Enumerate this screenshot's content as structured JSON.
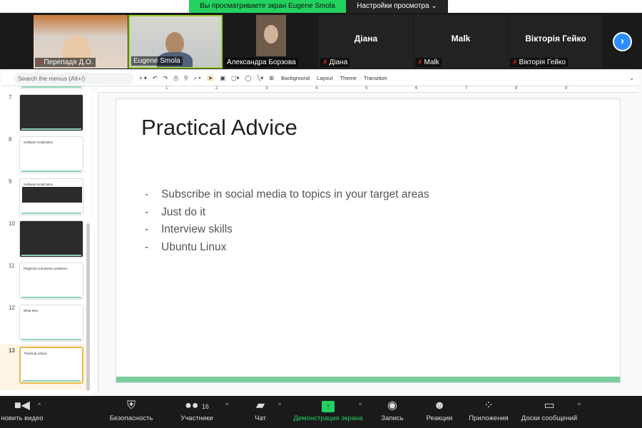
{
  "banner": {
    "text": "Вы просматриваете экран Eugene Smola",
    "settings": "Настройки просмотра"
  },
  "participants": [
    {
      "name": "Перепадя Д.О.",
      "muted": true
    },
    {
      "name": "Eugene Smola",
      "muted": false
    },
    {
      "name": "Александра Борзова",
      "muted": false
    },
    {
      "name": "Діана",
      "muted": true
    },
    {
      "name": "Malk",
      "muted": true
    },
    {
      "name": "Вікторія Гейко",
      "muted": true
    }
  ],
  "toolbar": {
    "search_placeholder": "Search the menus (Alt+/)",
    "background": "Background",
    "layout": "Layout",
    "theme": "Theme",
    "transition": "Transition"
  },
  "thumbnails": [
    {
      "num": "7",
      "title": ""
    },
    {
      "num": "8",
      "title": "Software localization"
    },
    {
      "num": "9",
      "title": "Software localization"
    },
    {
      "num": "10",
      "title": ""
    },
    {
      "num": "11",
      "title": "Plugins/to translation problems"
    },
    {
      "num": "12",
      "title": "What else"
    },
    {
      "num": "13",
      "title": "Practical Advice"
    }
  ],
  "ruler": [
    "1",
    "2",
    "3",
    "4",
    "5",
    "6",
    "7",
    "8",
    "9"
  ],
  "slide": {
    "title": "Practical Advice",
    "bullets": [
      "Subscribe in social media to topics in your target areas",
      "Just do it",
      "Interview skills",
      "Ubuntu Linux"
    ],
    "dash": "-"
  },
  "bottom": {
    "video": "новить видео",
    "security": "Безопасность",
    "participants": "Участники",
    "participants_count": "16",
    "chat": "Чат",
    "share": "Демонстрация экрана",
    "record": "Запись",
    "reactions": "Реакции",
    "apps": "Приложения",
    "whiteboards": "Доски сообщений"
  }
}
